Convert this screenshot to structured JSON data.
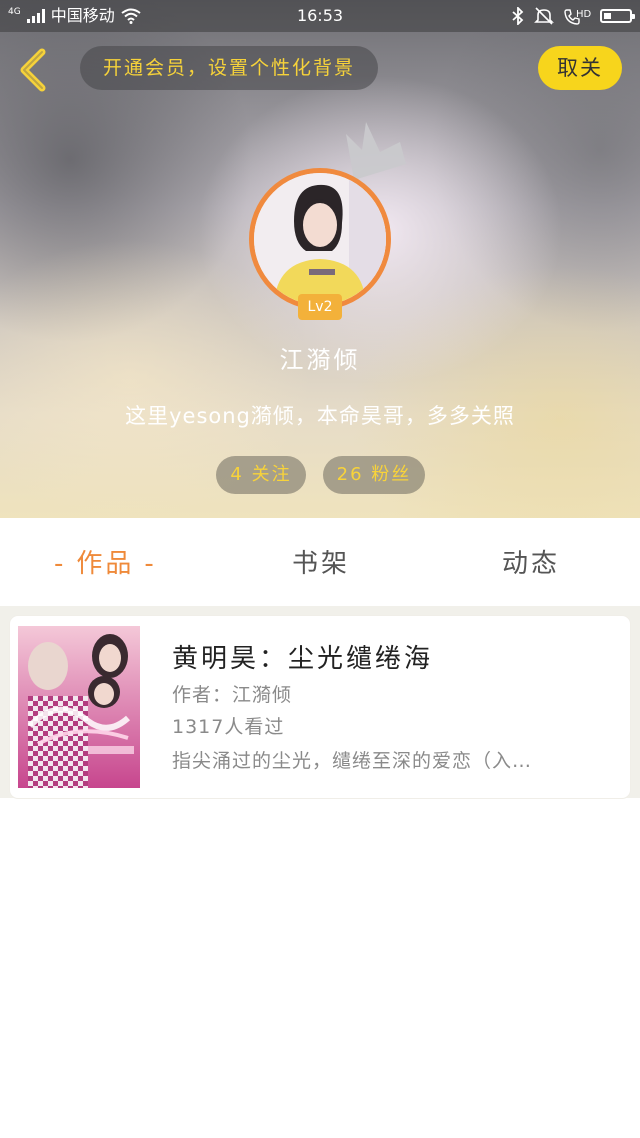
{
  "status_bar": {
    "network": "4G",
    "carrier": "中国移动",
    "time": "16:53",
    "hd_label": "HD"
  },
  "header": {
    "vip_banner": "开通会员，设置个性化背景",
    "unfollow_label": "取关"
  },
  "profile": {
    "level": "Lv2",
    "username": "江漪倾",
    "bio": "这里yesong漪倾，本命昊哥，多多关照",
    "following": "4 关注",
    "fans": "26 粉丝"
  },
  "tabs": [
    {
      "label": "作品",
      "active": true
    },
    {
      "label": "书架",
      "active": false
    },
    {
      "label": "动态",
      "active": false
    }
  ],
  "works": [
    {
      "title": "黄明昊：尘光缱绻海",
      "author": "作者：江漪倾",
      "views": "1317人看过",
      "description": "指尖涌过的尘光，缱绻至深的爱恋（入…"
    }
  ],
  "colors": {
    "accent_orange": "#ef8a3a",
    "accent_yellow": "#f7d51c",
    "badge_yellow": "#f3b13a"
  },
  "icons": {
    "back": "chevron-left-icon",
    "crown": "crown-icon",
    "bluetooth": "bluetooth-icon",
    "mute": "bell-muted-icon",
    "call": "hd-call-icon",
    "wifi": "wifi-icon",
    "signal": "signal-icon",
    "battery": "battery-icon"
  }
}
